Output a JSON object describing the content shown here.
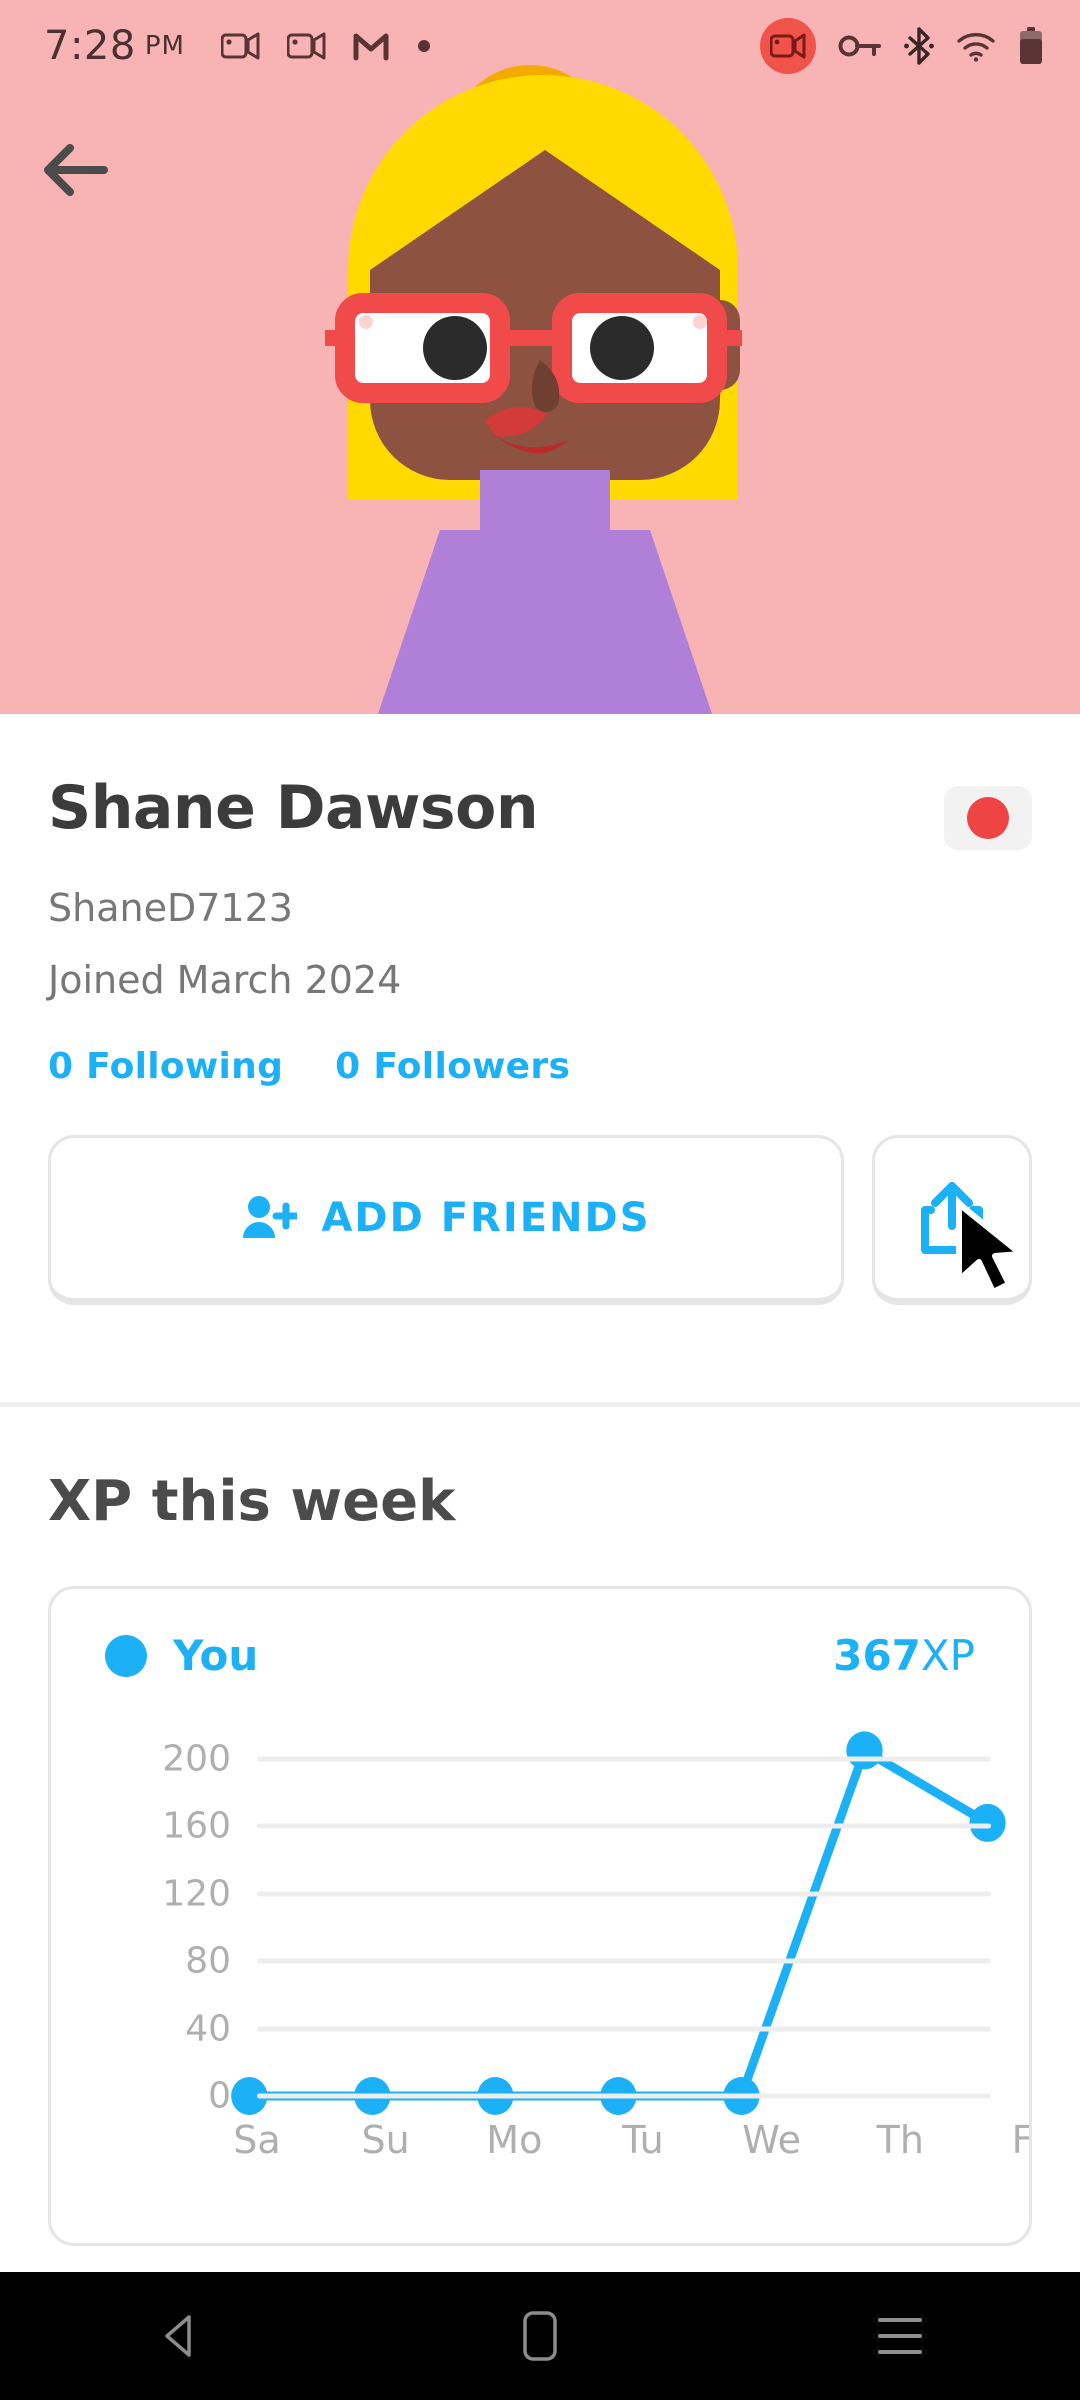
{
  "status_bar": {
    "time": "7:28",
    "ampm": "PM",
    "left_icons": [
      "video-camera-icon",
      "video-camera-icon",
      "gmail-icon",
      "dot-icon"
    ],
    "right_icons": [
      "screen-recording-icon",
      "vpn-key-icon",
      "bluetooth-icon",
      "wifi-icon",
      "battery-icon"
    ],
    "recording_badge_color": "#f0534a"
  },
  "header": {
    "background_color": "#f8b4b4",
    "back_label": "back-arrow",
    "avatar": {
      "hair_color": "#ffc800",
      "bun_color": "#f5aa00",
      "skin_color": "#8e5340",
      "glasses_color": "#f04a4a",
      "shirt_color": "#b07fd8",
      "lip_color": "#d33a3a"
    }
  },
  "profile": {
    "name": "Shane Dawson",
    "username": "ShaneD7123",
    "joined": "Joined March 2024",
    "flag": "japan-flag",
    "flag_dot_color": "#ef4444",
    "following": "0 Following",
    "followers": "0 Followers",
    "accent_color": "#1cb0f6",
    "add_friends_label": "ADD FRIENDS",
    "add_friends_icon": "person-add-icon",
    "share_icon": "share-icon"
  },
  "xp": {
    "title": "XP this week",
    "legend_label": "You",
    "legend_dot_color": "#1cb0f6",
    "total_value": "367",
    "total_unit": "XP"
  },
  "chart_data": {
    "type": "line",
    "title": "XP this week",
    "series": [
      {
        "name": "You",
        "color": "#1cb0f6",
        "values": [
          0,
          0,
          0,
          0,
          0,
          205,
          162
        ]
      }
    ],
    "categories": [
      "Sa",
      "Su",
      "Mo",
      "Tu",
      "We",
      "Th",
      "Fr"
    ],
    "yticks": [
      200,
      160,
      120,
      80,
      40,
      0
    ],
    "ylim": [
      0,
      210
    ],
    "xlabel": "",
    "ylabel": "",
    "grid": true,
    "legend_position": "top-left",
    "annotations": {
      "total": "367 XP"
    }
  },
  "navbar": {
    "back": "nav-back-icon",
    "home": "nav-home-icon",
    "recents": "nav-recents-icon"
  }
}
